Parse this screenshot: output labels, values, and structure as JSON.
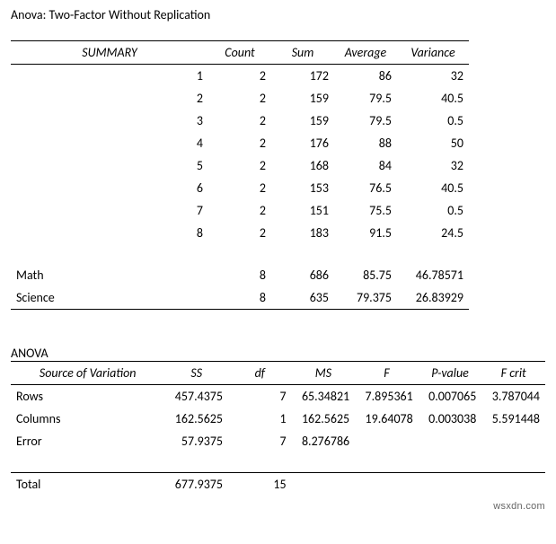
{
  "title": "Anova: Two-Factor Without Replication",
  "summary": {
    "headers": {
      "label": "SUMMARY",
      "count": "Count",
      "sum": "Sum",
      "average": "Average",
      "variance": "Variance"
    },
    "rows": [
      {
        "id": "1",
        "count": "2",
        "sum": "172",
        "average": "86",
        "variance": "32"
      },
      {
        "id": "2",
        "count": "2",
        "sum": "159",
        "average": "79.5",
        "variance": "40.5"
      },
      {
        "id": "3",
        "count": "2",
        "sum": "159",
        "average": "79.5",
        "variance": "0.5"
      },
      {
        "id": "4",
        "count": "2",
        "sum": "176",
        "average": "88",
        "variance": "50"
      },
      {
        "id": "5",
        "count": "2",
        "sum": "168",
        "average": "84",
        "variance": "32"
      },
      {
        "id": "6",
        "count": "2",
        "sum": "153",
        "average": "76.5",
        "variance": "40.5"
      },
      {
        "id": "7",
        "count": "2",
        "sum": "151",
        "average": "75.5",
        "variance": "0.5"
      },
      {
        "id": "8",
        "count": "2",
        "sum": "183",
        "average": "91.5",
        "variance": "24.5"
      }
    ],
    "groups": [
      {
        "name": "Math",
        "count": "8",
        "sum": "686",
        "average": "85.75",
        "variance": "46.78571"
      },
      {
        "name": "Science",
        "count": "8",
        "sum": "635",
        "average": "79.375",
        "variance": "26.83929"
      }
    ]
  },
  "anova": {
    "title": "ANOVA",
    "headers": {
      "source": "Source of Variation",
      "ss": "SS",
      "df": "df",
      "ms": "MS",
      "f": "F",
      "pvalue": "P-value",
      "fcrit": "F crit"
    },
    "rows": [
      {
        "source": "Rows",
        "ss": "457.4375",
        "df": "7",
        "ms": "65.34821",
        "f": "7.895361",
        "p": "0.007065",
        "fcrit": "3.787044"
      },
      {
        "source": "Columns",
        "ss": "162.5625",
        "df": "1",
        "ms": "162.5625",
        "f": "19.64078",
        "p": "0.003038",
        "fcrit": "5.591448"
      },
      {
        "source": "Error",
        "ss": "57.9375",
        "df": "7",
        "ms": "8.276786",
        "f": "",
        "p": "",
        "fcrit": ""
      }
    ],
    "total": {
      "source": "Total",
      "ss": "677.9375",
      "df": "15"
    }
  },
  "brand": "wsxdn.com"
}
